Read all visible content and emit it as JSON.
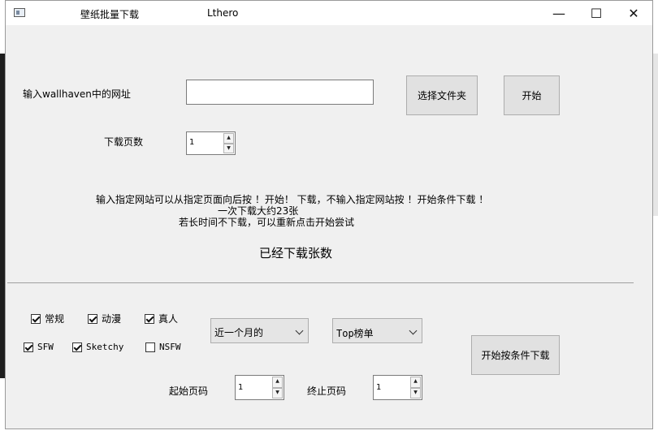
{
  "window": {
    "title": "壁纸批量下载",
    "author": "Lthero",
    "minimize_glyph": "—",
    "maximize_glyph": "☐",
    "close_glyph": "✕"
  },
  "url_section": {
    "label": "输入wallhaven中的网址",
    "url_value": "",
    "choose_folder_label": "选择文件夹",
    "start_label": "开始"
  },
  "pages_section": {
    "label": "下载页数",
    "value": "1"
  },
  "info": {
    "line1": "输入指定网站可以从指定页面向后按 ！开始！ 下载，不输入指定网站按 ！开始条件下载 ！",
    "line2": "一次下载大约23张",
    "line3": "若长时间不下载，可以重新点击开始尝试",
    "downloaded_label": "已经下载张数"
  },
  "filters": {
    "categories": [
      {
        "label": "常规",
        "checked": true
      },
      {
        "label": "动漫",
        "checked": true
      },
      {
        "label": "真人",
        "checked": true
      }
    ],
    "purity": [
      {
        "label": "SFW",
        "checked": true
      },
      {
        "label": "Sketchy",
        "checked": true
      },
      {
        "label": "NSFW",
        "checked": false
      }
    ],
    "time_range_value": "近一个月的",
    "sort_value": "Top榜单",
    "start_page_label": "起始页码",
    "start_page_value": "1",
    "end_page_label": "终止页码",
    "end_page_value": "1",
    "conditional_download_label": "开始按条件下载"
  }
}
